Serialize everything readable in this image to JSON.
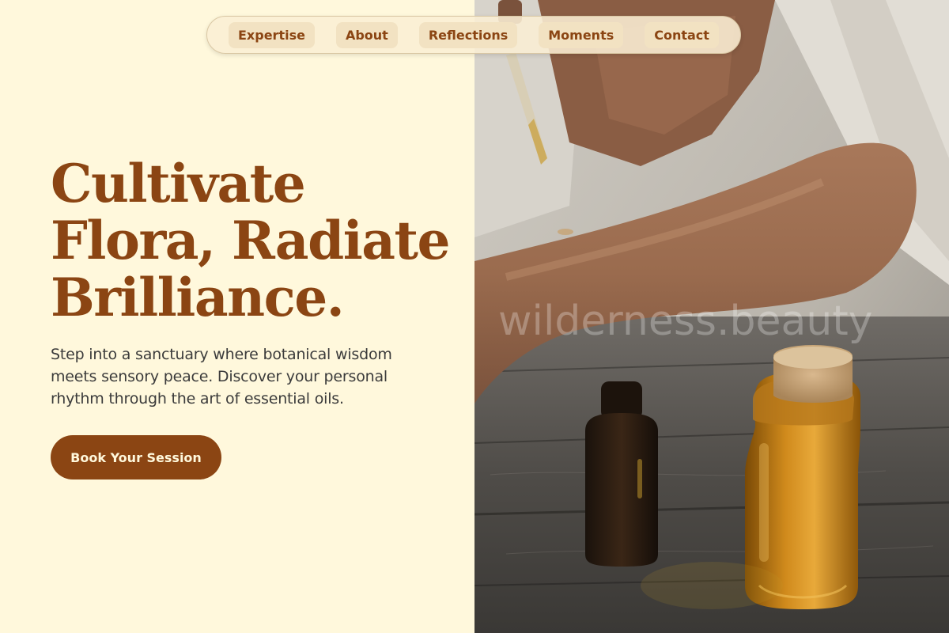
{
  "nav": {
    "items": [
      {
        "label": "Expertise"
      },
      {
        "label": "About"
      },
      {
        "label": "Reflections"
      },
      {
        "label": "Moments"
      },
      {
        "label": "Contact"
      }
    ]
  },
  "hero": {
    "title_line1": "Cultivate",
    "title_line2": "Flora, Radiate",
    "title_line3": "Brilliance.",
    "subtitle": "Step into a sanctuary where botanical wisdom meets sensory peace. Discover your personal rhythm through the art of essential oils.",
    "cta_label": "Book Your Session"
  },
  "photo": {
    "watermark": "wilderness.beauty",
    "subject_icons": [
      "dropper-icon",
      "amber-bottle-icon",
      "cork-jar-icon"
    ]
  },
  "colors": {
    "background": "#FFF8DC",
    "accent": "#8B4513",
    "nav_pill": "#F2E2C2",
    "text": "#3b3b3b"
  }
}
